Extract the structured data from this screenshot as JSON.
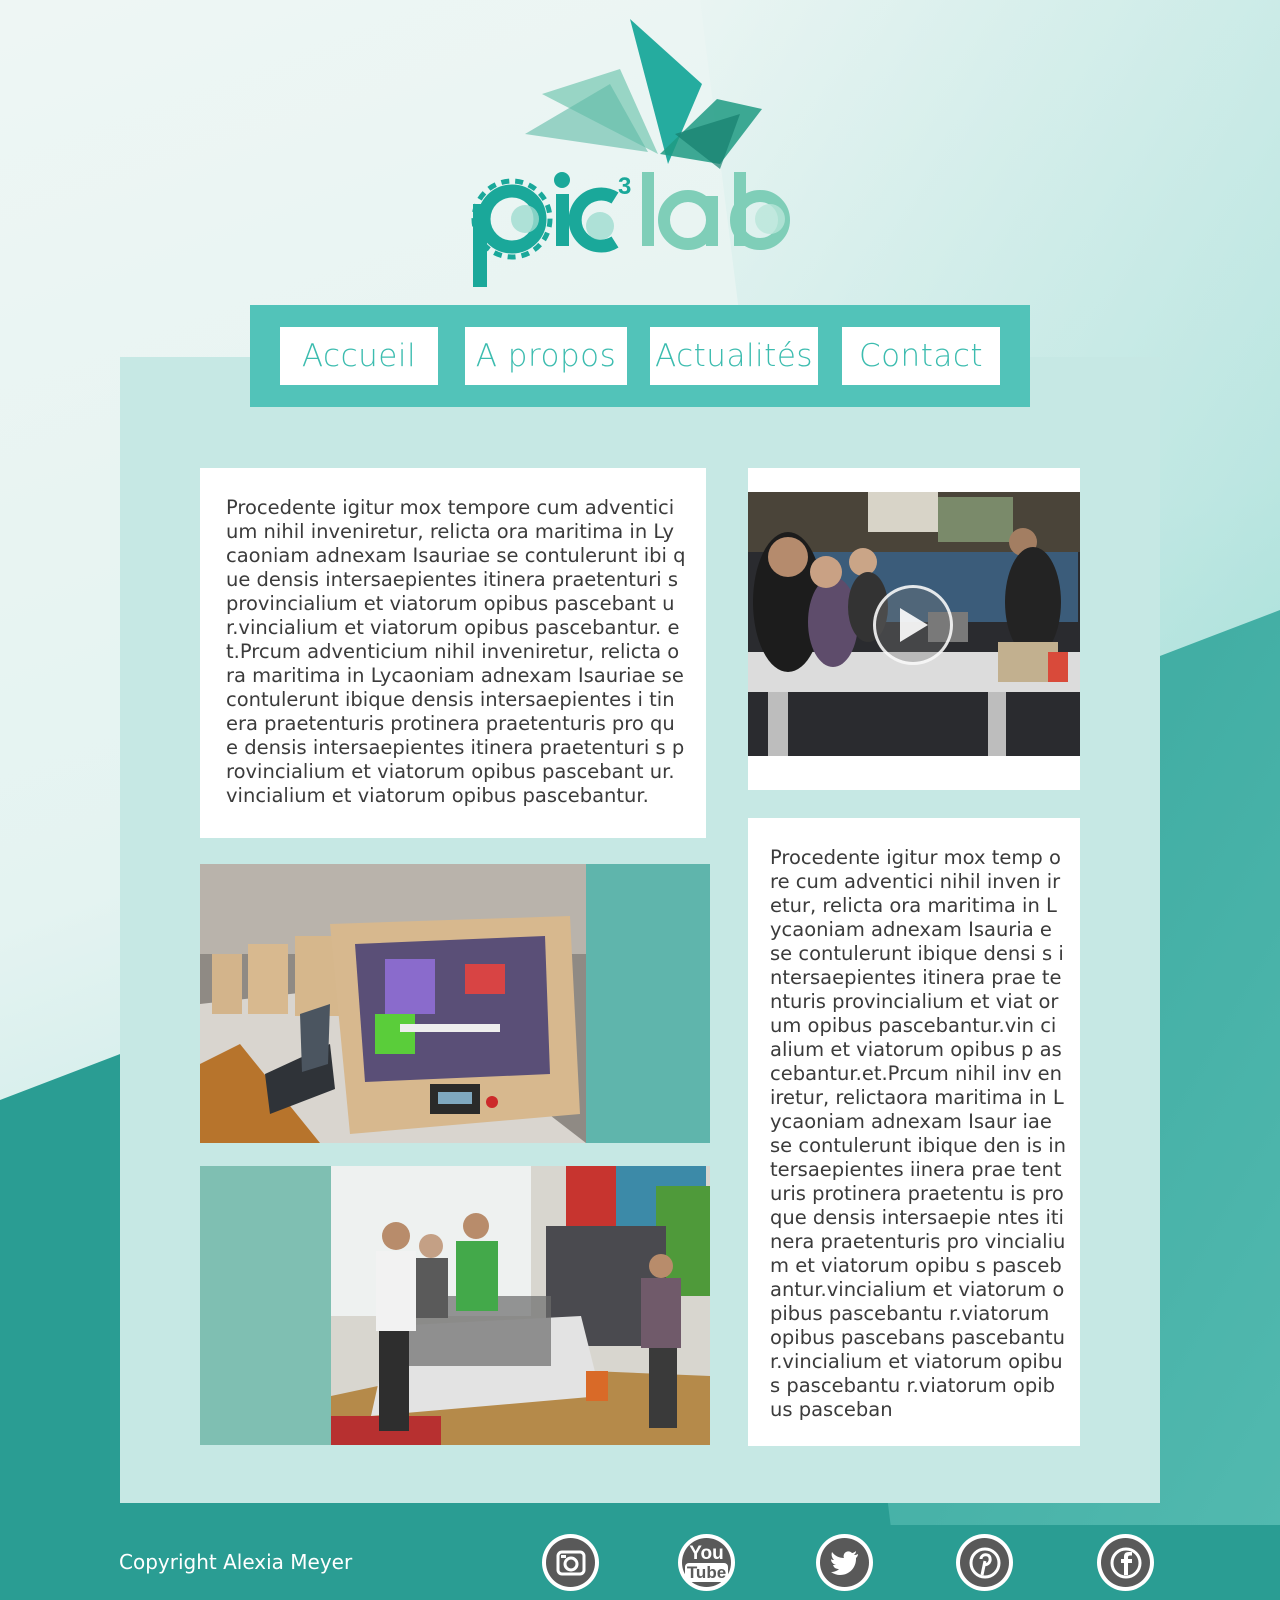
{
  "brand": {
    "logo_name": "pic³lab",
    "logo_main": "pic",
    "logo_sup": "3",
    "logo_tail": "lab"
  },
  "nav": {
    "items": [
      {
        "label": "Accueil"
      },
      {
        "label": "A propos"
      },
      {
        "label": "Actualités"
      },
      {
        "label": "Contact"
      }
    ]
  },
  "content": {
    "text_block_1": "Procedente igitur mox tempore cum adventici um nihil inveniretur, relicta ora maritima in Ly caoniam adnexam Isauriae se contulerunt ibi que densis intersaepientes itinera praetenturi s provincialium et viatorum opibus pascebant ur.vincialium et viatorum opibus pascebantur. et.Prcum adventicium nihil inveniretur, relicta ora maritima in Lycaoniam adnexam Isauriae se contulerunt ibique densis intersaepientes i tinera praetenturis protinera praetenturis pro que densis intersaepientes itinera praetenturi s provincialium et viatorum opibus pascebant ur.vincialium et viatorum opibus pascebantur.",
    "text_block_2": "Procedente igitur mox temp ore cum adventici nihil inven iretur, relicta ora maritima in  Lycaoniam adnexam Isauria e se contulerunt ibique densi s intersaepientes itinera prae tenturis provincialium et viat orum opibus pascebantur.vin cialium et viatorum opibus p ascebantur.et.Prcum nihil inv eniretur, relictaora maritima in Lycaoniam adnexam Isaur iae se contulerunt ibique den is intersaepientes iinera prae tenturis protinera praetentu is proque densis intersaepie ntes itinera praetenturis pro vincialium et viatorum opibu s pascebantur.vincialium et viatorum opibus pascebantu r.viatorum opibus pascebans pascebantur.vincialium et viatorum opibus pascebantu r.viatorum opibus pasceban",
    "video_icon": "play-icon"
  },
  "footer": {
    "copyright": "Copyright Alexia Meyer",
    "social": [
      {
        "name": "instagram-icon"
      },
      {
        "name": "youtube-icon",
        "text_top": "You",
        "text_bottom": "Tube"
      },
      {
        "name": "twitter-icon"
      },
      {
        "name": "pinterest-icon"
      },
      {
        "name": "facebook-icon"
      }
    ]
  },
  "colors": {
    "brand_teal": "#2a9d93",
    "nav_teal": "#52c3b9",
    "panel_bg": "#c6e8e4",
    "nav_text": "#3cbcaf"
  }
}
